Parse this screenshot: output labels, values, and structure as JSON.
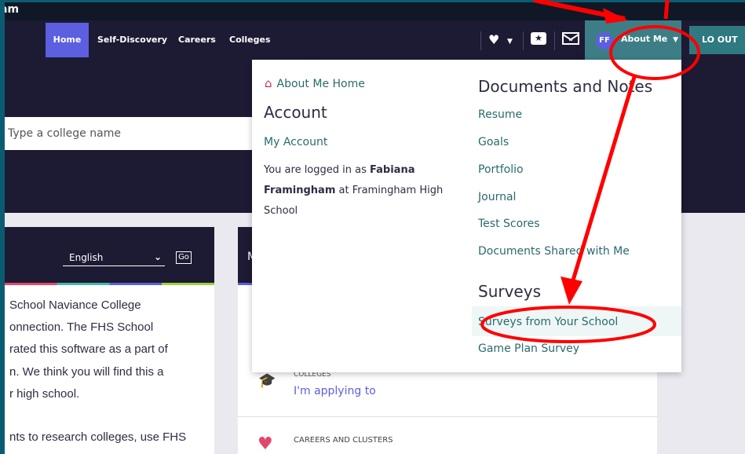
{
  "brand_fragment": "am",
  "nav": {
    "home": "Home",
    "self_discovery": "Self-Discovery",
    "careers": "Careers",
    "colleges": "Colleges"
  },
  "header": {
    "avatar_initials": "FF",
    "about_me": "About Me",
    "logout": "LO OUT"
  },
  "search": {
    "placeholder": "Type a college name"
  },
  "language": {
    "selected": "English",
    "go": "Go"
  },
  "intro_lines": [
    "School Naviance College",
    "onnection. The FHS School",
    "rated this software as a part of",
    "n. We think you will find this a",
    "r high school.",
    "nts to research colleges, use FHS"
  ],
  "right_panel": {
    "header_fragment": "M",
    "section1_label": "COLLEGES",
    "section1_link": "I'm applying to",
    "section2_label": "CAREERS AND CLUSTERS"
  },
  "dropdown": {
    "about_me_home": "About Me Home",
    "account_heading": "Account",
    "my_account": "My Account",
    "logged_in_prefix": "You are logged in as",
    "user_name": "Fabiana Framingham",
    "logged_in_suffix": "at Framingham High School",
    "documents_heading": "Documents and Notes",
    "documents_items": [
      "Resume",
      "Goals",
      "Portfolio",
      "Journal",
      "Test Scores",
      "Documents Shared with Me"
    ],
    "surveys_heading": "Surveys",
    "survey_items": [
      "Surveys from Your School",
      "Game Plan Survey"
    ]
  },
  "colors": {
    "nav_bg": "#1d1a33",
    "accent": "#5b5fe0",
    "teal": "#3d7e86",
    "link": "#2a6a6e",
    "annotation": "#ff0000"
  },
  "icons": [
    "heart-icon",
    "star-message-icon",
    "mail-icon",
    "house-icon",
    "graduation-cap-icon"
  ]
}
